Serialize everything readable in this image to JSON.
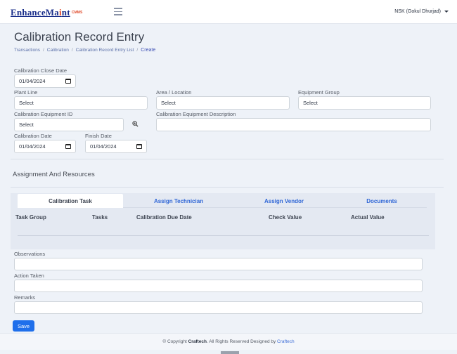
{
  "header": {
    "logo_main": "EnhanceMa",
    "logo_i": "i",
    "logo_rest": "nt",
    "logo_sub": "CMMS",
    "user_label": "NSK  (Gokul Dhurjad)"
  },
  "page": {
    "title": "Calibration Record Entry",
    "breadcrumb": [
      "Transactions",
      "Calibration",
      "Calibration Record Entry List",
      "Create"
    ]
  },
  "form": {
    "close_date_label": "Calibration Close Date",
    "close_date_value": "01/04/2024",
    "plant_line_label": "Plant Line",
    "plant_line_value": "Select",
    "area_label": "Area / Location",
    "area_value": "Select",
    "equipment_group_label": "Equipment Group",
    "equipment_group_value": "Select",
    "cal_equipment_id_label": "Calibration Equipment ID",
    "cal_equipment_id_value": "Select",
    "cal_equipment_desc_label": "Calibration Equipment Description",
    "cal_equipment_desc_value": "",
    "calibration_date_label": "Calibration Date",
    "calibration_date_value": "01/04/2024",
    "finish_date_label": "Finish Date",
    "finish_date_value": "01/04/2024"
  },
  "assignment": {
    "title": "Assignment And Resources",
    "tabs": [
      "Calibration Task",
      "Assign Technician",
      "Assign Vendor",
      "Documents"
    ],
    "active_tab": "Calibration Task",
    "columns": [
      "Task Group",
      "Tasks",
      "Calibration Due Date",
      "Check Value",
      "Actual Value"
    ]
  },
  "notes": {
    "observations_label": "Observations",
    "action_taken_label": "Action Taken",
    "remarks_label": "Remarks"
  },
  "actions": {
    "save_label": "Save"
  },
  "footer": {
    "prefix": "© Copyright ",
    "company": "Craftech",
    "middle": ". All Rights Reserved Designed by ",
    "designer": "Craftech"
  },
  "colors": {
    "primary": "#1f6feb",
    "link": "#2f66d6",
    "brand": "#1a2e8a",
    "brand_accent": "#e04a2a"
  },
  "icons": {
    "menu": "hamburger-icon",
    "date": "calendar-icon",
    "lookup": "zoom-icon"
  }
}
